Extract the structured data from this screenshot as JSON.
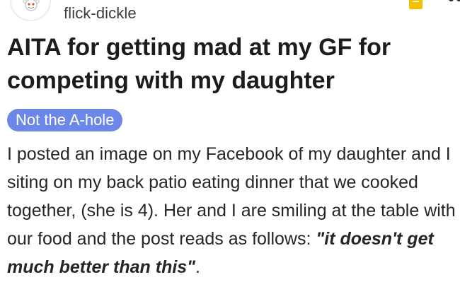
{
  "post": {
    "username": "flick-dickle",
    "title": "AITA for getting mad at my GF for competing with my daughter",
    "flair": "Not the A-hole",
    "body_lead": "I posted an image on my Facebook of my daughter and I siting on my back patio eating dinner that we cooked together, (she is 4). Her and I are smiling at the table with our food and the post reads as follows: ",
    "body_quote": "\"it doesn't get much better than this\"",
    "body_end": "."
  },
  "icons": {
    "avatar": "snoo-avatar-icon",
    "award": "award-icon",
    "more": "more-options-icon"
  },
  "colors": {
    "flair_bg": "#6d87e8",
    "flair_text": "#ffffff",
    "award": "#f2c200"
  }
}
